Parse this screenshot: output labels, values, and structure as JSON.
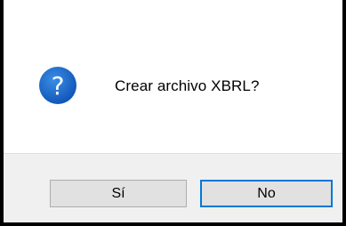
{
  "dialog": {
    "icon": "question-icon",
    "icon_glyph": "?",
    "icon_color": "#1565c0",
    "message": "Crear archivo XBRL?",
    "buttons": {
      "yes_label": "Sí",
      "no_label": "No"
    },
    "default_button_border_color": "#0078d7"
  }
}
